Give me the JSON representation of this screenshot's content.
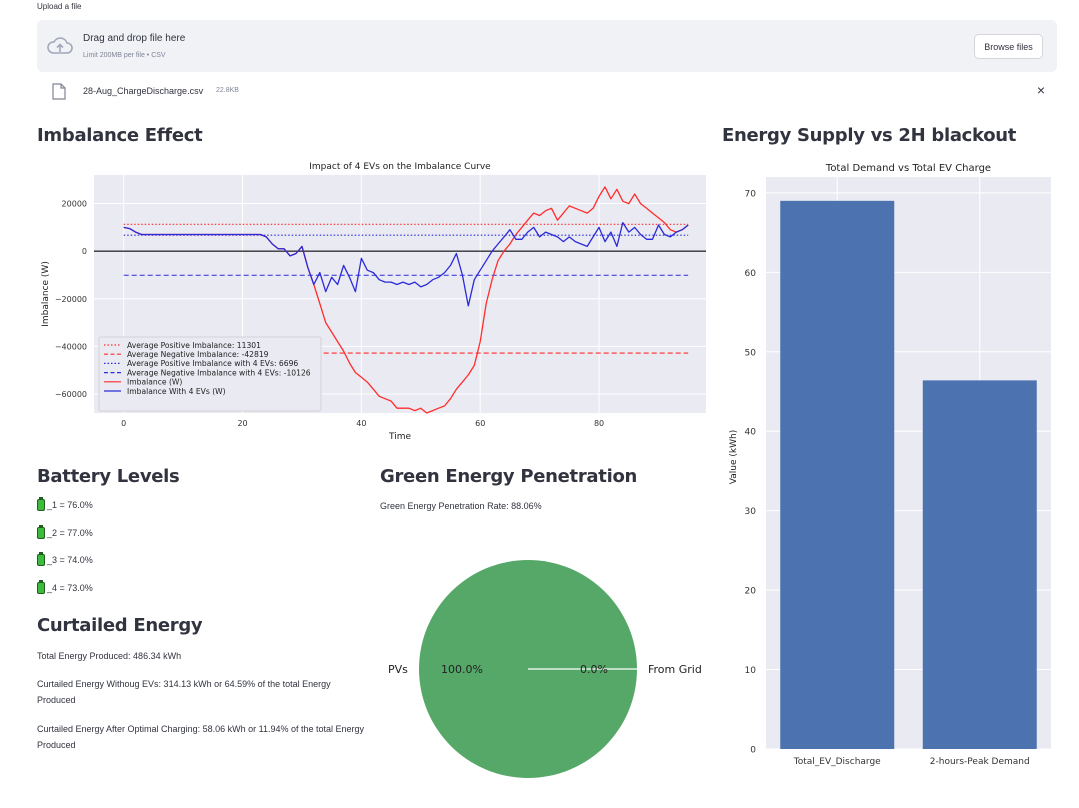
{
  "uploader": {
    "label": "Upload a file",
    "drop_title": "Drag and drop file here",
    "drop_subtitle": "Limit 200MB per file • CSV",
    "browse_label": "Browse files",
    "file_name": "28-Aug_ChargeDischarge.csv",
    "file_size": "22.8KB",
    "remove_icon": "×"
  },
  "sections": {
    "imbalance_title": "Imbalance Effect",
    "supply_title": "Energy Supply vs 2H blackout",
    "battery_title": "Battery Levels",
    "green_title": "Green Energy Penetration",
    "curtailed_title": "Curtailed Energy"
  },
  "battery": {
    "items": [
      "_1 = 76.0%",
      "_2 = 77.0%",
      "_3 = 74.0%",
      "_4 = 73.0%"
    ],
    "levels": [
      76.0,
      77.0,
      74.0,
      73.0
    ]
  },
  "green": {
    "rate_text": "Green Energy Penetration Rate: 88.06%"
  },
  "curtailed": {
    "total": "Total Energy Produced: 486.34 kWh",
    "without_evs": "Curtailed Energy Withoug EVs: 314.13 kWh or 64.59% of the total Energy Produced",
    "after_optimal": "Curtailed Energy After Optimal Charging: 58.06 kWh or 11.94% of the total Energy Produced"
  },
  "colors": {
    "red": "#ff2d2d",
    "blue": "#2b2bd9",
    "bar": "#4c72b0",
    "pie_green": "#55a868",
    "plot_bg": "#eaeaf2"
  },
  "chart_data": [
    {
      "type": "line",
      "title": "Impact of 4 EVs on the Imbalance Curve",
      "xlabel": "Time",
      "ylabel": "Imbalance (W)",
      "xlim": [
        -5,
        98
      ],
      "ylim": [
        -68000,
        32000
      ],
      "xticks": [
        0,
        20,
        40,
        60,
        80
      ],
      "yticks": [
        20000,
        0,
        -20000,
        -40000,
        -60000
      ],
      "ytick_labels": [
        "20000",
        "0",
        "−20000",
        "−40000",
        "−60000"
      ],
      "grid": true,
      "legend_position": "lower-left",
      "hlines": [
        {
          "name": "Average Positive Imbalance: 11301",
          "y": 11301,
          "color": "red",
          "style": "dotted"
        },
        {
          "name": "Average Negative Imbalance: -42819",
          "y": -42819,
          "color": "red",
          "style": "dashed"
        },
        {
          "name": "Average Positive Imbalance with 4 EVs: 6696",
          "y": 6696,
          "color": "blue",
          "style": "dotted"
        },
        {
          "name": "Average Negative Imbalance with 4 EVs: -10126",
          "y": -10126,
          "color": "blue",
          "style": "dashed"
        }
      ],
      "series": [
        {
          "name": "Imbalance (W)",
          "color": "red",
          "x": [
            0,
            1,
            2,
            3,
            4,
            5,
            6,
            7,
            8,
            9,
            10,
            11,
            12,
            13,
            14,
            15,
            16,
            17,
            18,
            19,
            20,
            21,
            22,
            23,
            24,
            25,
            26,
            27,
            28,
            29,
            30,
            31,
            32,
            33,
            34,
            35,
            36,
            37,
            38,
            39,
            40,
            41,
            42,
            43,
            44,
            45,
            46,
            47,
            48,
            49,
            50,
            51,
            52,
            53,
            54,
            55,
            56,
            57,
            58,
            59,
            60,
            61,
            62,
            63,
            64,
            65,
            66,
            67,
            68,
            69,
            70,
            71,
            72,
            73,
            74,
            75,
            76,
            77,
            78,
            79,
            80,
            81,
            82,
            83,
            84,
            85,
            86,
            87,
            88,
            89,
            90,
            91,
            92,
            93,
            94,
            95
          ],
          "values": [
            10000,
            9500,
            8000,
            7000,
            7000,
            7000,
            7000,
            7000,
            7000,
            7000,
            7000,
            7000,
            7000,
            7000,
            7000,
            7000,
            7000,
            7000,
            7000,
            7000,
            7000,
            7000,
            7000,
            7000,
            6000,
            3000,
            1000,
            1000,
            -2000,
            -1000,
            2000,
            -7000,
            -14000,
            -22000,
            -30000,
            -34000,
            -38000,
            -42000,
            -47000,
            -51000,
            -53000,
            -55000,
            -58000,
            -61000,
            -62000,
            -63000,
            -66000,
            -66000,
            -66000,
            -67000,
            -66000,
            -68000,
            -67000,
            -66000,
            -65000,
            -62000,
            -58000,
            -55000,
            -52000,
            -48000,
            -38000,
            -22000,
            -12000,
            -4000,
            0,
            3000,
            7000,
            10000,
            13000,
            16000,
            15000,
            17000,
            18000,
            13000,
            16000,
            19000,
            18000,
            17000,
            16000,
            18000,
            23000,
            27000,
            22000,
            26000,
            21000,
            20000,
            24000,
            20000,
            18000,
            16000,
            14000,
            12000,
            9000,
            8000,
            9000,
            11000
          ]
        },
        {
          "name": "Imbalance With 4 EVs (W)",
          "color": "blue",
          "x": [
            0,
            1,
            2,
            3,
            4,
            5,
            6,
            7,
            8,
            9,
            10,
            11,
            12,
            13,
            14,
            15,
            16,
            17,
            18,
            19,
            20,
            21,
            22,
            23,
            24,
            25,
            26,
            27,
            28,
            29,
            30,
            31,
            32,
            33,
            34,
            35,
            36,
            37,
            38,
            39,
            40,
            41,
            42,
            43,
            44,
            45,
            46,
            47,
            48,
            49,
            50,
            51,
            52,
            53,
            54,
            55,
            56,
            57,
            58,
            59,
            60,
            61,
            62,
            63,
            64,
            65,
            66,
            67,
            68,
            69,
            70,
            71,
            72,
            73,
            74,
            75,
            76,
            77,
            78,
            79,
            80,
            81,
            82,
            83,
            84,
            85,
            86,
            87,
            88,
            89,
            90,
            91,
            92,
            93,
            94,
            95
          ],
          "values": [
            10000,
            9500,
            8000,
            7000,
            7000,
            7000,
            7000,
            7000,
            7000,
            7000,
            7000,
            7000,
            7000,
            7000,
            7000,
            7000,
            7000,
            7000,
            7000,
            7000,
            7000,
            7000,
            7000,
            7000,
            6000,
            3000,
            1000,
            1000,
            -2000,
            -1000,
            2000,
            -7000,
            -14000,
            -9000,
            -17000,
            -11000,
            -14000,
            -6000,
            -11000,
            -17000,
            -3000,
            -8000,
            -9000,
            -12000,
            -13000,
            -13000,
            -14000,
            -13000,
            -14000,
            -13000,
            -15000,
            -14000,
            -12000,
            -11000,
            -9000,
            -6000,
            -1000,
            -10000,
            -23000,
            -12000,
            -8000,
            -4000,
            0,
            3000,
            6000,
            9000,
            5000,
            5000,
            8000,
            10000,
            6000,
            8000,
            7000,
            6000,
            4000,
            6000,
            4000,
            3000,
            2000,
            6000,
            10000,
            4000,
            8000,
            2000,
            12000,
            8000,
            10000,
            7000,
            5000,
            5000,
            11000,
            7000,
            6000,
            8000,
            9000,
            11000
          ]
        }
      ]
    },
    {
      "type": "bar",
      "title": "Total Demand vs Total EV Charge",
      "categories": [
        "Total_EV_Discharge",
        "2-hours-Peak Demand"
      ],
      "values": [
        69.0,
        46.4
      ],
      "ylabel": "Value (kWh)",
      "ylim": [
        0,
        72
      ],
      "yticks": [
        0,
        10,
        20,
        30,
        40,
        50,
        60,
        70
      ],
      "grid": true
    },
    {
      "type": "pie",
      "labels": [
        "PVs",
        "From Grid"
      ],
      "values": [
        100.0,
        0.0
      ],
      "autopct": [
        "100.0%",
        "0.0%"
      ]
    }
  ]
}
